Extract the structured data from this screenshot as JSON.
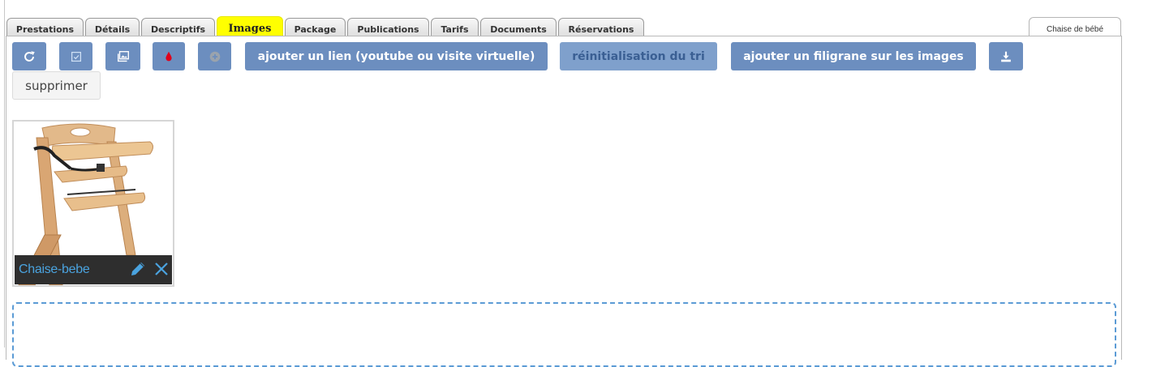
{
  "tabs": [
    {
      "label": "Prestations",
      "active": false
    },
    {
      "label": "Détails",
      "active": false
    },
    {
      "label": "Descriptifs",
      "active": false
    },
    {
      "label": "Images",
      "active": true
    },
    {
      "label": "Package",
      "active": false
    },
    {
      "label": "Publications",
      "active": false
    },
    {
      "label": "Tarifs",
      "active": false
    },
    {
      "label": "Documents",
      "active": false
    },
    {
      "label": "Réservations",
      "active": false
    }
  ],
  "side_tab": {
    "label": "Chaise de bébé"
  },
  "toolbar": {
    "icon_buttons": [
      "refresh-icon",
      "checkbox-icon",
      "gallery-icon",
      "drop-icon",
      "plus-circle-icon"
    ],
    "add_link_label": "ajouter un lien (youtube ou visite virtuelle)",
    "reset_sort_label": "réinitialisation du tri",
    "watermark_label": "ajouter un filigrane sur les images",
    "download_icon": "download-icon",
    "delete_label": "supprimer"
  },
  "images": [
    {
      "title": "Chaise-bebe",
      "icon_edit": "pencil-icon",
      "icon_delete": "close-icon"
    }
  ],
  "colors": {
    "highlight": "#ffff00",
    "button": "#6c8ebf",
    "caption_bg": "#2e2e2e",
    "caption_text": "#4aa3df",
    "dropzone_border": "#5b9bd5"
  }
}
